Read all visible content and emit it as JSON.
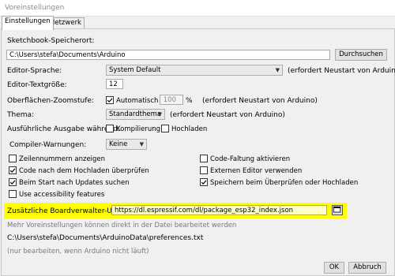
{
  "window": {
    "title": "Voreinstellungen"
  },
  "tabs": [
    {
      "label": "Einstellungen"
    },
    {
      "label": "Netzwerk"
    }
  ],
  "sketchbook": {
    "label": "Sketchbook-Speicherort:",
    "value": "C:\\Users\\stefa\\Documents\\Arduino",
    "browse_button": "Durchsuchen"
  },
  "editor_language": {
    "label": "Editor-Sprache:",
    "value": "System Default",
    "note": "(erfordert Neustart von Arduino)"
  },
  "editor_font_size": {
    "label": "Editor-Textgröße:",
    "value": "12"
  },
  "zoom": {
    "label": "Oberflächen-Zoomstufe:",
    "auto_label": "Automatisch",
    "auto_checked": true,
    "value": "100",
    "unit": "%",
    "note": "(erfordert Neustart von Arduino)"
  },
  "theme": {
    "label": "Thema:",
    "value": "Standardthema",
    "note": "(erfordert Neustart von Arduino)"
  },
  "verbose": {
    "label": "Ausführliche Ausgabe während:",
    "compile_label": "Kompilierung",
    "compile_checked": false,
    "upload_label": "Hochladen",
    "upload_checked": false
  },
  "compiler_warnings": {
    "label": "Compiler-Warnungen:",
    "value": "Keine"
  },
  "checkboxes": {
    "line_numbers": {
      "label": "Zeilennummern anzeigen",
      "checked": false
    },
    "code_folding": {
      "label": "Code-Faltung aktivieren",
      "checked": false
    },
    "verify_after_upload": {
      "label": "Code nach dem Hochladen überprüfen",
      "checked": true
    },
    "external_editor": {
      "label": "Externen Editor verwenden",
      "checked": false
    },
    "check_updates": {
      "label": "Beim Start nach Updates suchen",
      "checked": true
    },
    "save_on_verify": {
      "label": "Speichern beim Überprüfen oder Hochladen",
      "checked": true
    },
    "accessibility": {
      "label": "Use accessibility features",
      "checked": false
    }
  },
  "board_urls": {
    "label": "Zusätzliche Boardverwalter-URLs:",
    "value": "https://dl.espressif.com/dl/package_esp32_index.json",
    "highlight_color": "#ffff00"
  },
  "footer": {
    "more_prefs": "Mehr Voreinstellungen können direkt in der Datei bearbeitet werden",
    "prefs_path": "C:\\Users\\stefa\\Documents\\ArduinoData\\preferences.txt",
    "edit_note": "(nur bearbeiten, wenn Arduino nicht läuft)"
  },
  "buttons": {
    "ok": "OK",
    "cancel": "Abbruch"
  }
}
